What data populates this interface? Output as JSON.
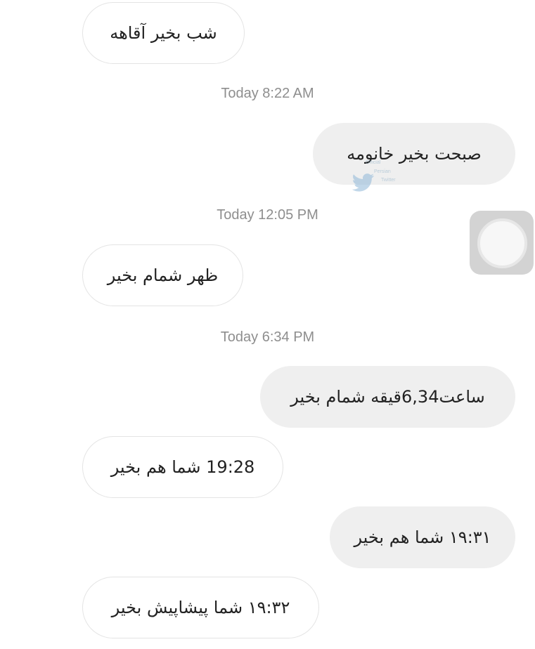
{
  "messages": [
    {
      "text": "شب بخیر آقاهه",
      "side": "received"
    },
    {
      "timestamp": "Today 8:22 AM"
    },
    {
      "text": "صبحت بخیر خانومه",
      "side": "sent"
    },
    {
      "timestamp": "Today 12:05 PM"
    },
    {
      "text": "ظهر شمام بخیر",
      "side": "received"
    },
    {
      "timestamp": "Today 6:34 PM"
    },
    {
      "text": "ساعت6,34قیقه شمام بخیر",
      "side": "sent"
    },
    {
      "text": "19:28 شما هم بخیر",
      "side": "received"
    },
    {
      "text": "۱۹:۳۱ شما هم بخیر",
      "side": "sent"
    },
    {
      "text": "۱۹:۳۲ شما پیشاپیش بخیر",
      "side": "received"
    }
  ],
  "watermark": {
    "line1": "Official",
    "line2": "Persian",
    "line3": "Twitter",
    "icon": "twitter-bird-icon"
  },
  "assistive_touch": {
    "icon": "assistive-touch-icon"
  },
  "colors": {
    "received_bubble": "#ffffff",
    "sent_bubble": "#efefef",
    "timestamp_text": "#8e8e8e",
    "message_text": "#222222"
  }
}
